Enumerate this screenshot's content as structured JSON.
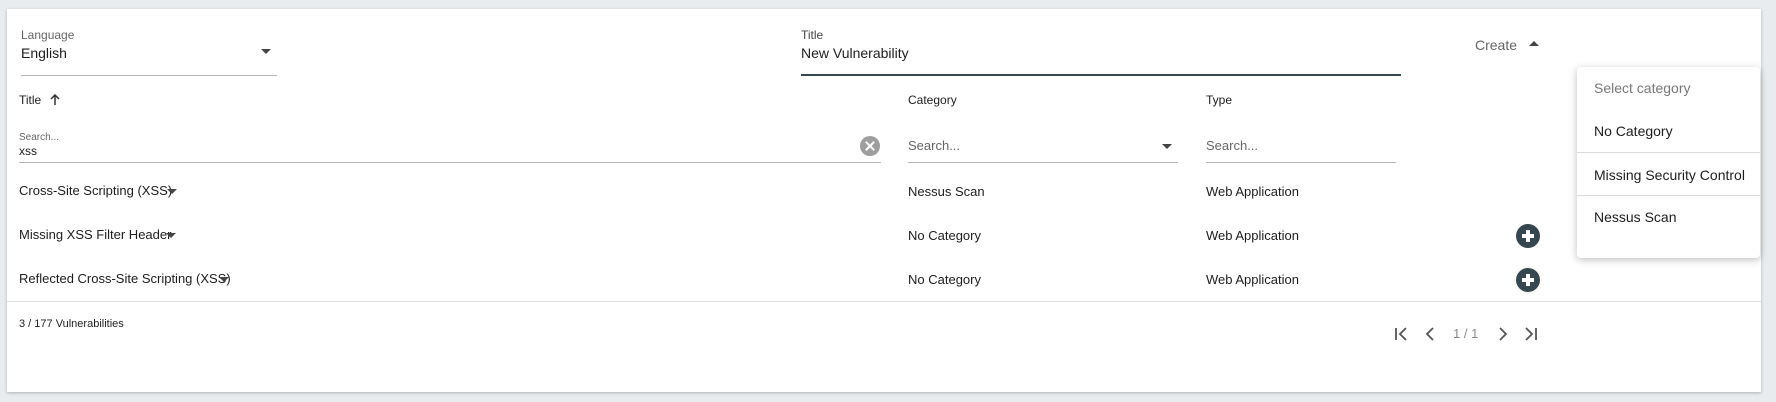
{
  "form": {
    "language": {
      "label": "Language",
      "value": "English"
    },
    "title": {
      "label": "Title",
      "value": "New Vulnerability"
    },
    "create_label": "Create"
  },
  "category_menu": {
    "placeholder": "Select category",
    "options": [
      "No Category",
      "Missing Security Control",
      "Nessus Scan"
    ]
  },
  "table": {
    "headers": {
      "title": "Title",
      "category": "Category",
      "type": "Type"
    },
    "filters": {
      "title_label": "Search...",
      "title_value": "xss",
      "category_placeholder": "Search...",
      "type_placeholder": "Search..."
    },
    "rows": [
      {
        "title": "Cross-Site Scripting (XSS)",
        "category": "Nessus Scan",
        "type": "Web Application"
      },
      {
        "title": "Missing XSS Filter Header",
        "category": "No Category",
        "type": "Web Application"
      },
      {
        "title": "Reflected Cross-Site Scripting (XSS)",
        "category": "No Category",
        "type": "Web Application"
      }
    ]
  },
  "footer": {
    "count": "3 / 177 Vulnerabilities",
    "page": "1 / 1"
  },
  "icons": {
    "sort": "arrow-up-icon",
    "dropdown": "caret-down-icon",
    "clear": "clear-icon",
    "add": "plus-circle-icon",
    "first": "first-page-icon",
    "prev": "chevron-left-icon",
    "next": "chevron-right-icon",
    "last": "last-page-icon"
  }
}
